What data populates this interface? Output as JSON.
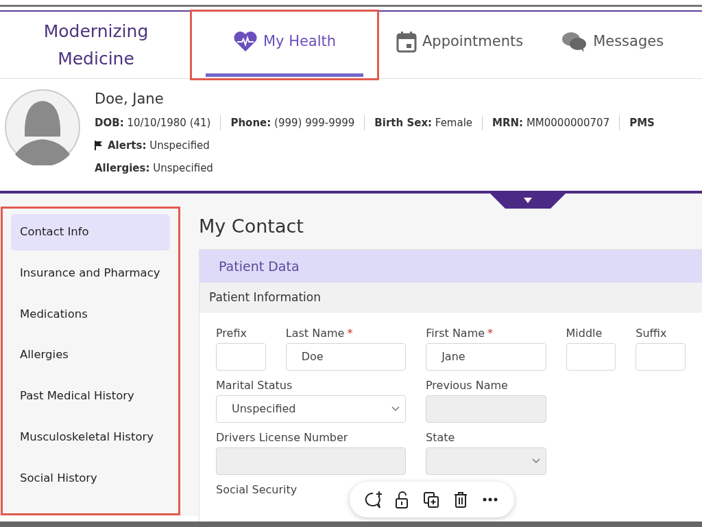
{
  "logo": "Modernizing Medicine",
  "tabs": [
    {
      "label": "My Health",
      "selected": true,
      "highlighted": true
    },
    {
      "label": "Appointments",
      "selected": false,
      "highlighted": false
    },
    {
      "label": "Messages",
      "selected": false,
      "highlighted": false
    }
  ],
  "patient": {
    "name": "Doe, Jane",
    "details": [
      {
        "label": "DOB:",
        "value": "10/10/1980 (41)"
      },
      {
        "label": "Phone:",
        "value": "(999) 999-9999"
      },
      {
        "label": "Birth Sex:",
        "value": "Female"
      },
      {
        "label": "MRN:",
        "value": "MM0000000707"
      },
      {
        "label": "PMS"
      }
    ],
    "alerts": {
      "label": "Alerts:",
      "value": "Unspecified"
    },
    "allergies": {
      "label": "Allergies:",
      "value": "Unspecified"
    }
  },
  "sidebar": {
    "highlighted": true,
    "items": [
      {
        "label": "Contact Info",
        "selected": true
      },
      {
        "label": "Insurance and Pharmacy",
        "selected": false
      },
      {
        "label": "Medications",
        "selected": false
      },
      {
        "label": "Allergies",
        "selected": false
      },
      {
        "label": "Past Medical History",
        "selected": false
      },
      {
        "label": "Musculoskeletal History",
        "selected": false
      },
      {
        "label": "Social History",
        "selected": false
      }
    ]
  },
  "page_title": "My Contact",
  "card": {
    "title": "Patient Data",
    "section": "Patient Information",
    "rows": [
      [
        {
          "label": "Prefix",
          "kind": "text",
          "disabled": false
        },
        {
          "label": "Last Name",
          "marker": "*",
          "kind": "text",
          "value": "Doe",
          "disabled": false
        },
        {
          "label": "First Name",
          "marker": "*",
          "kind": "text",
          "value": "Jane",
          "disabled": false
        },
        {
          "label": "Middle",
          "kind": "text",
          "disabled": false
        },
        {
          "label": "Suffix",
          "kind": "text",
          "disabled": false
        }
      ],
      [
        {
          "label": "Marital Status",
          "kind": "select",
          "value": "Unspecified",
          "disabled": false
        },
        {
          "label": "Previous Name",
          "kind": "text",
          "disabled": true
        }
      ],
      [
        {
          "label": "Drivers License Number",
          "kind": "text",
          "disabled": true
        },
        {
          "label": "State",
          "kind": "select",
          "disabled": true
        }
      ],
      [
        {
          "label": "Social Security",
          "kind": "label"
        }
      ]
    ]
  },
  "toolbar": [
    {
      "kind": "comment-add"
    },
    {
      "kind": "unlock"
    },
    {
      "kind": "duplicate"
    },
    {
      "kind": "delete"
    },
    {
      "kind": "more"
    }
  ]
}
